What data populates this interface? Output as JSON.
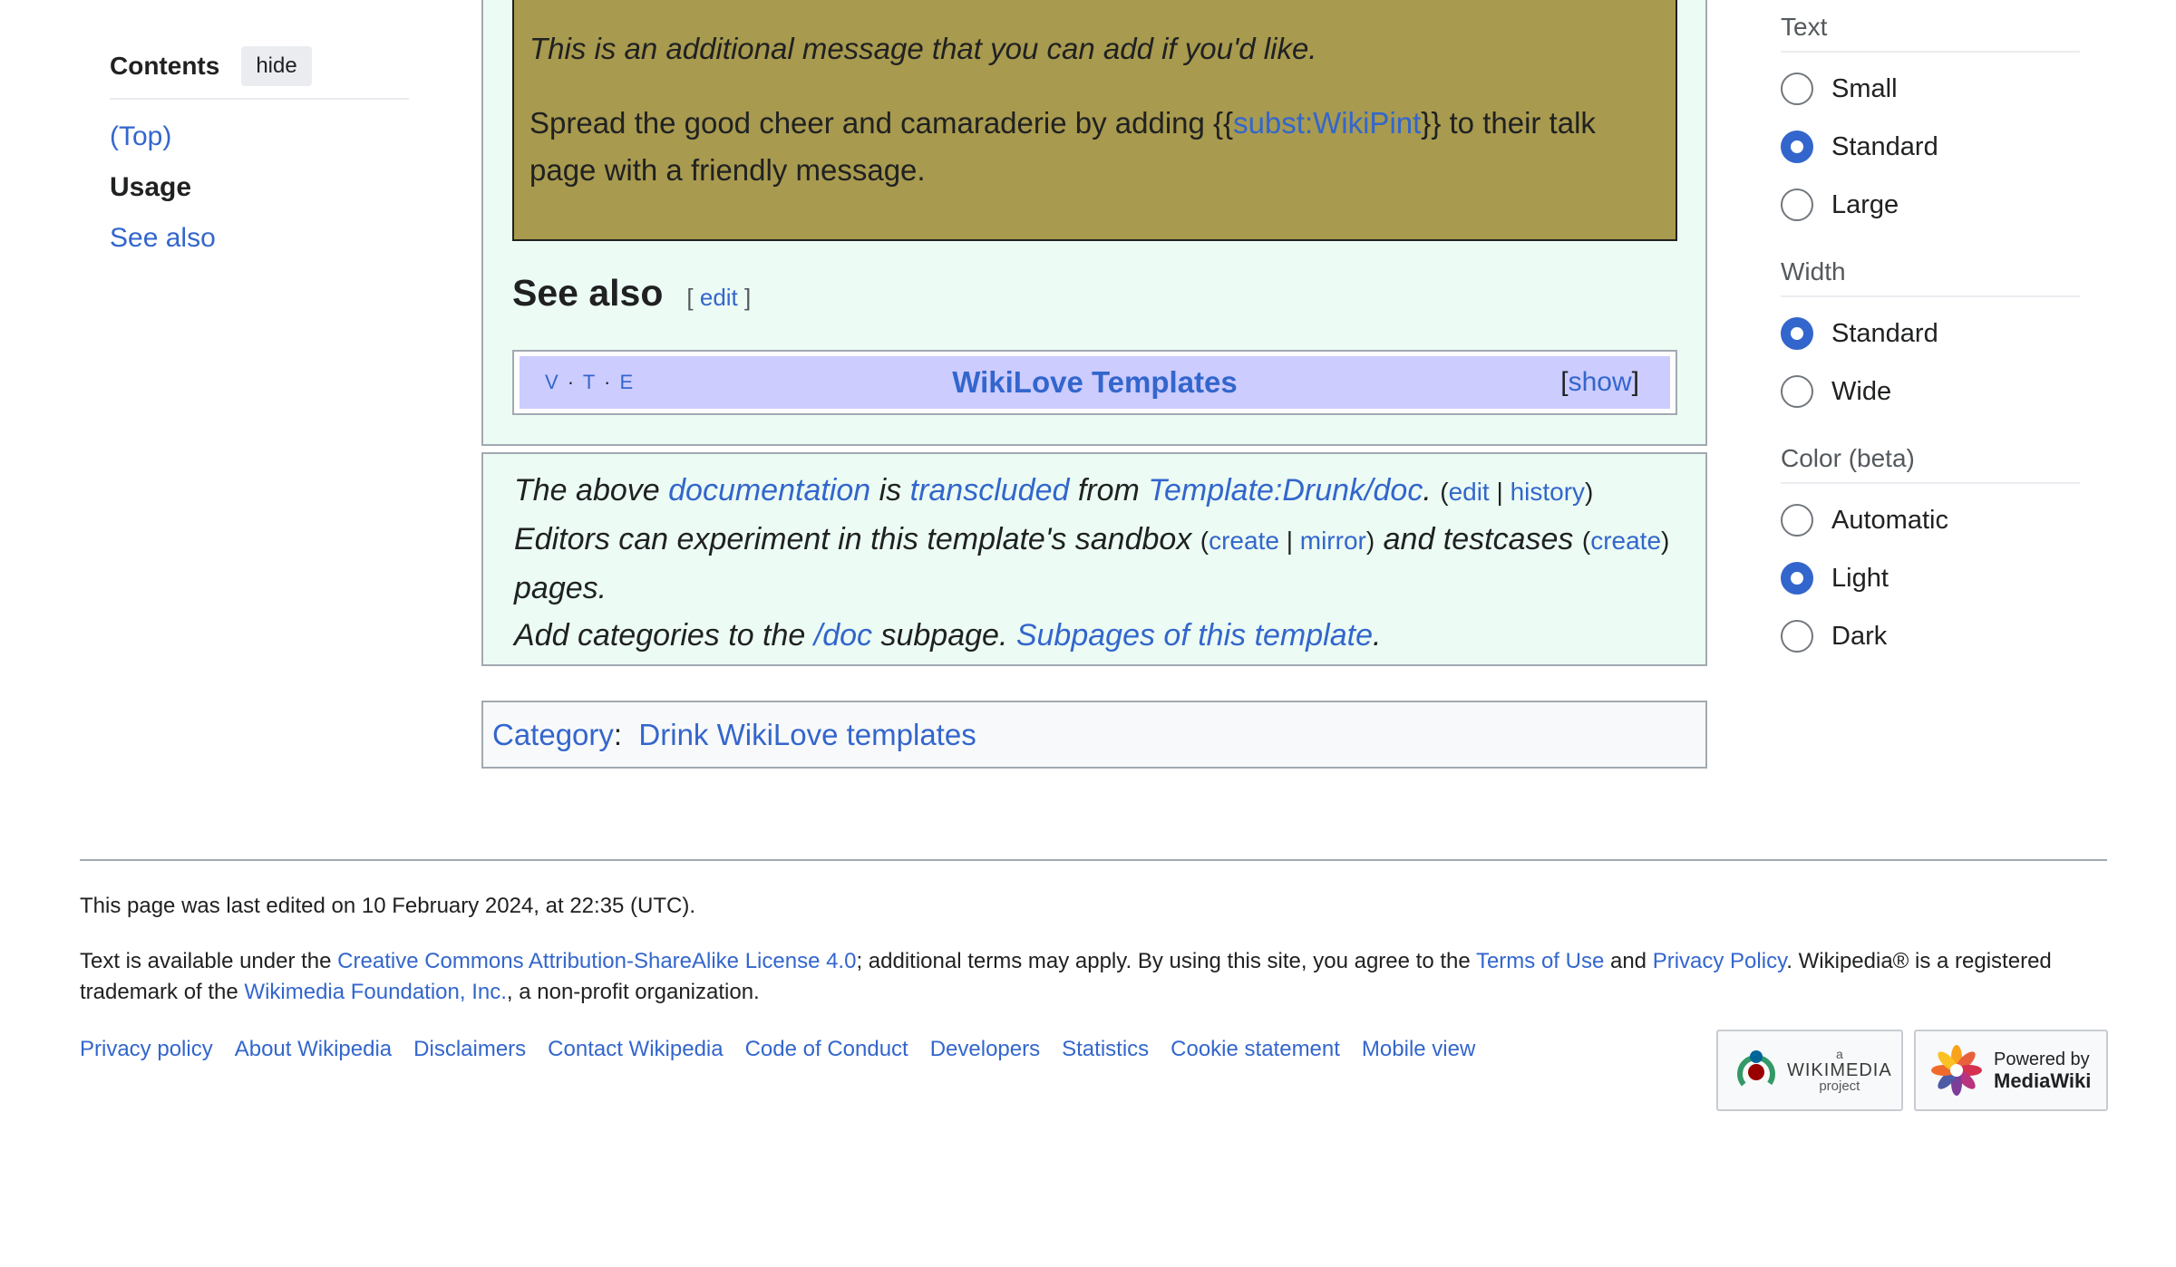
{
  "toc": {
    "title": "Contents",
    "hide_label": "hide",
    "items": [
      "(Top)",
      "Usage",
      "See also"
    ]
  },
  "appearance": {
    "text": {
      "title": "Text",
      "options": [
        "Small",
        "Standard",
        "Large"
      ],
      "selected": "Standard"
    },
    "width": {
      "title": "Width",
      "options": [
        "Standard",
        "Wide"
      ],
      "selected": "Standard"
    },
    "color": {
      "title": "Color (beta)",
      "options": [
        "Automatic",
        "Light",
        "Dark"
      ],
      "selected": "Light"
    }
  },
  "message_box": {
    "italic_line": "This is an additional message that you can add if you'd like.",
    "line_before": "Spread the good cheer and camaraderie by adding {{",
    "link": "subst:WikiPint",
    "line_after": "}} to their talk page with a friendly message."
  },
  "see_also": {
    "heading": "See also",
    "edit_open": "[",
    "edit": "edit",
    "edit_close": "]"
  },
  "navbox": {
    "v": "V",
    "t": "T",
    "e": "E",
    "title": "WikiLove Templates",
    "show_open": "[",
    "show": "show",
    "show_close": "]"
  },
  "doc_note": {
    "l1_a": "The above ",
    "l1_link1": "documentation",
    "l1_b": " is ",
    "l1_link2": "transcluded",
    "l1_c": " from ",
    "l1_link3": "Template:Drunk/doc",
    "l1_d": ". ",
    "l1_paren_open": "(",
    "l1_edit": "edit",
    "l1_sep": " | ",
    "l1_history": "history",
    "l1_paren_close": ")",
    "l2_a": "Editors can experiment in this template's sandbox ",
    "l2_paren_open": "(",
    "l2_create": "create",
    "l2_sep": " | ",
    "l2_mirror": "mirror",
    "l2_paren_close": ")",
    "l2_b": " and testcases ",
    "l2_paren_open2": "(",
    "l2_create2": "create",
    "l2_paren_close2": ")",
    "l2_c": " pages.",
    "l3_a": "Add categories to the ",
    "l3_link1": "/doc",
    "l3_b": " subpage. ",
    "l3_link2": "Subpages of this template",
    "l3_c": "."
  },
  "catlinks": {
    "label": "Category",
    "colon": ":",
    "category": "Drink WikiLove templates"
  },
  "footer": {
    "last_edited": "This page was last edited on 10 February 2024, at 22:35 (UTC).",
    "lic_a": "Text is available under the ",
    "lic_link1": "Creative Commons Attribution-ShareAlike License 4.0",
    "lic_b": "; additional terms may apply. By using this site, you agree to the ",
    "lic_link2": "Terms of Use",
    "lic_c": " and ",
    "lic_link3": "Privacy Policy",
    "lic_d": ". Wikipedia® is a registered trademark of the ",
    "lic_link4": "Wikimedia Foundation, Inc.",
    "lic_e": ", a non-profit organization.",
    "links": [
      "Privacy policy",
      "About Wikipedia",
      "Disclaimers",
      "Contact Wikipedia",
      "Code of Conduct",
      "Developers",
      "Statistics",
      "Cookie statement",
      "Mobile view"
    ],
    "wikimedia_badge": {
      "small": "a",
      "name": "WIKIMEDIA",
      "sub": "project"
    },
    "mediawiki_badge": {
      "line1": "Powered by",
      "line2": "MediaWiki"
    }
  },
  "colors": {
    "link": "#3366cc",
    "doc_bg": "#ecfcf4",
    "message_bg": "#a89a4e",
    "navbox_title_bg": "#ccccff",
    "radio_checked": "#3366cc"
  }
}
